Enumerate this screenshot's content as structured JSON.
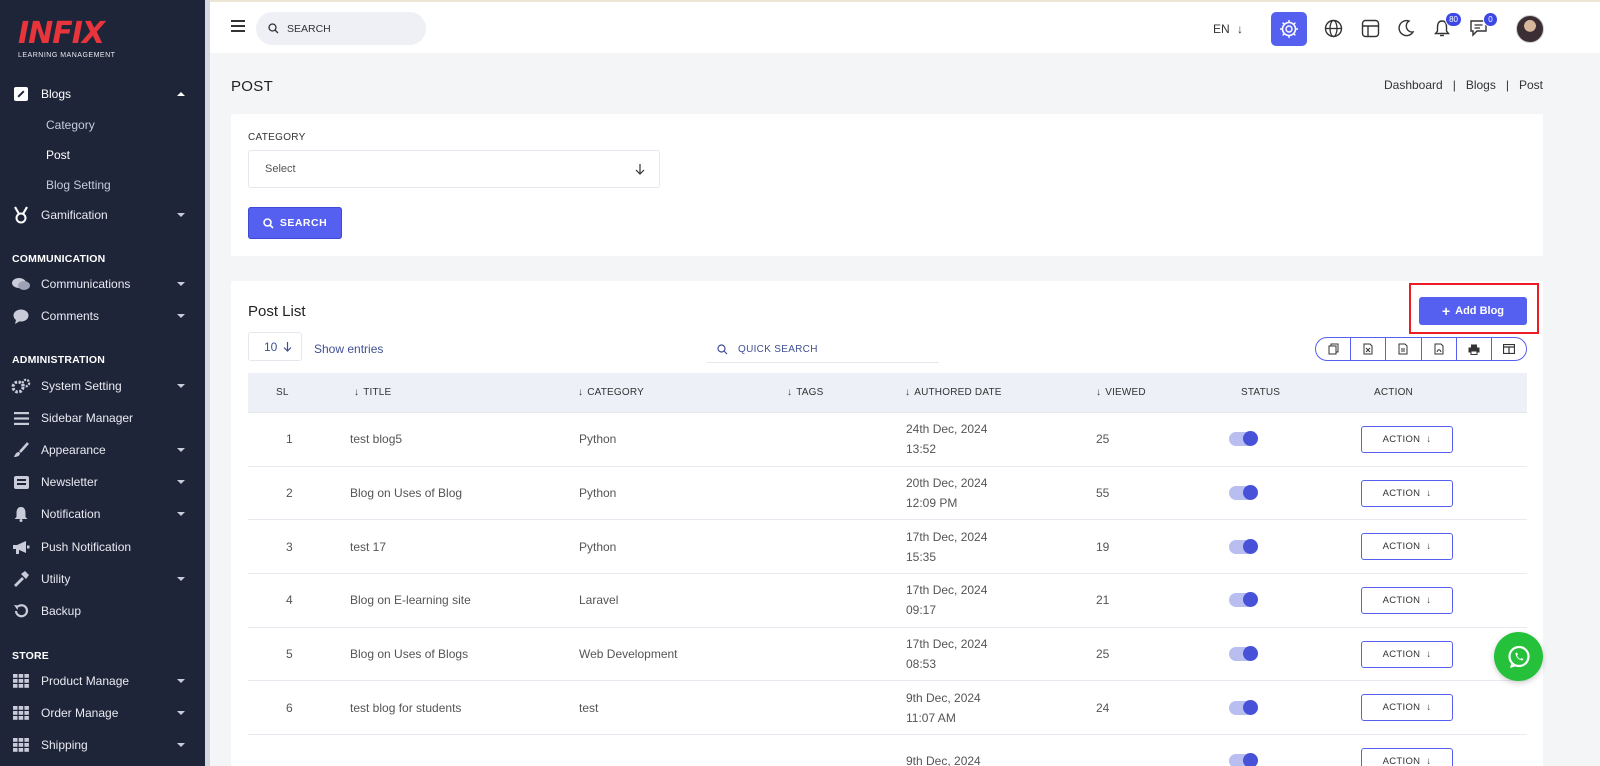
{
  "brand": {
    "logo_text": "INFIX",
    "logo_subtitle": "LEARNING MANAGEMENT"
  },
  "topbar": {
    "search_placeholder": "SEARCH",
    "language": "EN",
    "notification_count": "80",
    "message_count": "0"
  },
  "sidebar": {
    "blogs": "Blogs",
    "blogs_sub": [
      "Category",
      "Post",
      "Blog Setting"
    ],
    "gamification": "Gamification",
    "communication_head": "COMMUNICATION",
    "communications": "Communications",
    "comments": "Comments",
    "administration_head": "ADMINISTRATION",
    "system_setting": "System Setting",
    "sidebar_manager": "Sidebar Manager",
    "appearance": "Appearance",
    "newsletter": "Newsletter",
    "notification": "Notification",
    "push_notification": "Push Notification",
    "utility": "Utility",
    "backup": "Backup",
    "store_head": "STORE",
    "product_manage": "Product Manage",
    "order_manage": "Order Manage",
    "shipping": "Shipping"
  },
  "page": {
    "title": "POST",
    "breadcrumb": [
      "Dashboard",
      "Blogs",
      "Post"
    ]
  },
  "filter": {
    "category_label": "CATEGORY",
    "category_value": "Select",
    "search_button": "SEARCH"
  },
  "list": {
    "title": "Post List",
    "add_button": "Add Blog",
    "entries_value": "10",
    "show_entries": "Show entries",
    "quick_search_placeholder": "QUICK SEARCH",
    "columns": [
      "SL",
      "TITLE",
      "CATEGORY",
      "TAGS",
      "AUTHORED DATE",
      "VIEWED",
      "STATUS",
      "ACTION"
    ],
    "action_label": "ACTION",
    "rows": [
      {
        "sl": "1",
        "title": "test blog5",
        "category": "Python",
        "tags": "",
        "date": "24th Dec, 2024",
        "time": "13:52",
        "viewed": "25",
        "status": true
      },
      {
        "sl": "2",
        "title": "Blog on Uses of Blog",
        "category": "Python",
        "tags": "",
        "date": "20th Dec, 2024",
        "time": "12:09 PM",
        "viewed": "55",
        "status": true
      },
      {
        "sl": "3",
        "title": "test 17",
        "category": "Python",
        "tags": "",
        "date": "17th Dec, 2024",
        "time": "15:35",
        "viewed": "19",
        "status": true
      },
      {
        "sl": "4",
        "title": "Blog on E-learning site",
        "category": "Laravel",
        "tags": "",
        "date": "17th Dec, 2024",
        "time": "09:17",
        "viewed": "21",
        "status": true
      },
      {
        "sl": "5",
        "title": "Blog on Uses of Blogs",
        "category": "Web Development",
        "tags": "",
        "date": "17th Dec, 2024",
        "time": "08:53",
        "viewed": "25",
        "status": true
      },
      {
        "sl": "6",
        "title": "test blog for students",
        "category": "test",
        "tags": "",
        "date": "9th Dec, 2024",
        "time": "11:07 AM",
        "viewed": "24",
        "status": true
      },
      {
        "sl": "",
        "title": "",
        "category": "",
        "tags": "",
        "date": "9th Dec, 2024",
        "time": "",
        "viewed": "",
        "status": true
      }
    ]
  },
  "colors": {
    "primary": "#5560f0",
    "sidebar_bg": "#1e2538",
    "highlight": "#ee1c25",
    "whatsapp": "#25c13a"
  }
}
